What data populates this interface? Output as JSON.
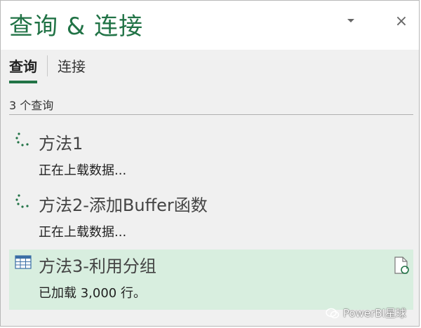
{
  "header": {
    "title": "查询 & 连接",
    "dropdown_icon": "chevron-down-icon",
    "close_label": "×"
  },
  "tabs": [
    {
      "label": "查询",
      "active": true
    },
    {
      "label": "连接",
      "active": false
    }
  ],
  "query_count": "3 个查询",
  "queries": [
    {
      "name": "方法1",
      "status": "正在上载数据...",
      "icon": "loading-spinner-icon",
      "selected": false
    },
    {
      "name": "方法2-添加Buffer函数",
      "status": "正在上载数据...",
      "icon": "loading-spinner-icon",
      "selected": false
    },
    {
      "name": "方法3-利用分组",
      "status": "已加载 3,000 行。",
      "icon": "table-icon",
      "selected": true,
      "action_icon": "refresh-document-icon"
    }
  ],
  "watermark": "PowerBI星球",
  "colors": {
    "accent": "#217346",
    "selected_row": "#d8eedf",
    "pane_bg": "#f0f0f0"
  }
}
